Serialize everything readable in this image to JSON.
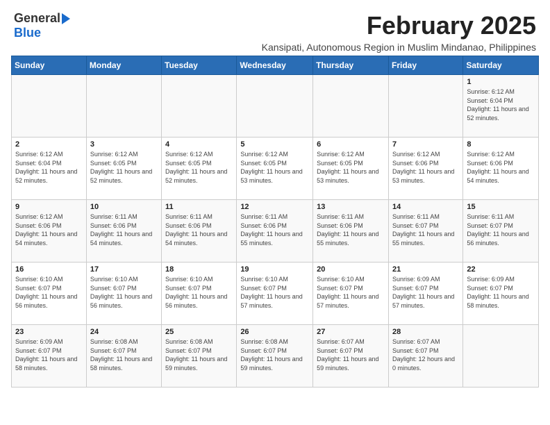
{
  "header": {
    "logo_general": "General",
    "logo_blue": "Blue",
    "main_title": "February 2025",
    "subtitle": "Kansipati, Autonomous Region in Muslim Mindanao, Philippines"
  },
  "calendar": {
    "days_of_week": [
      "Sunday",
      "Monday",
      "Tuesday",
      "Wednesday",
      "Thursday",
      "Friday",
      "Saturday"
    ],
    "weeks": [
      [
        {
          "day": "",
          "info": ""
        },
        {
          "day": "",
          "info": ""
        },
        {
          "day": "",
          "info": ""
        },
        {
          "day": "",
          "info": ""
        },
        {
          "day": "",
          "info": ""
        },
        {
          "day": "",
          "info": ""
        },
        {
          "day": "1",
          "info": "Sunrise: 6:12 AM\nSunset: 6:04 PM\nDaylight: 11 hours and 52 minutes."
        }
      ],
      [
        {
          "day": "2",
          "info": "Sunrise: 6:12 AM\nSunset: 6:04 PM\nDaylight: 11 hours and 52 minutes."
        },
        {
          "day": "3",
          "info": "Sunrise: 6:12 AM\nSunset: 6:05 PM\nDaylight: 11 hours and 52 minutes."
        },
        {
          "day": "4",
          "info": "Sunrise: 6:12 AM\nSunset: 6:05 PM\nDaylight: 11 hours and 52 minutes."
        },
        {
          "day": "5",
          "info": "Sunrise: 6:12 AM\nSunset: 6:05 PM\nDaylight: 11 hours and 53 minutes."
        },
        {
          "day": "6",
          "info": "Sunrise: 6:12 AM\nSunset: 6:05 PM\nDaylight: 11 hours and 53 minutes."
        },
        {
          "day": "7",
          "info": "Sunrise: 6:12 AM\nSunset: 6:06 PM\nDaylight: 11 hours and 53 minutes."
        },
        {
          "day": "8",
          "info": "Sunrise: 6:12 AM\nSunset: 6:06 PM\nDaylight: 11 hours and 54 minutes."
        }
      ],
      [
        {
          "day": "9",
          "info": "Sunrise: 6:12 AM\nSunset: 6:06 PM\nDaylight: 11 hours and 54 minutes."
        },
        {
          "day": "10",
          "info": "Sunrise: 6:11 AM\nSunset: 6:06 PM\nDaylight: 11 hours and 54 minutes."
        },
        {
          "day": "11",
          "info": "Sunrise: 6:11 AM\nSunset: 6:06 PM\nDaylight: 11 hours and 54 minutes."
        },
        {
          "day": "12",
          "info": "Sunrise: 6:11 AM\nSunset: 6:06 PM\nDaylight: 11 hours and 55 minutes."
        },
        {
          "day": "13",
          "info": "Sunrise: 6:11 AM\nSunset: 6:06 PM\nDaylight: 11 hours and 55 minutes."
        },
        {
          "day": "14",
          "info": "Sunrise: 6:11 AM\nSunset: 6:07 PM\nDaylight: 11 hours and 55 minutes."
        },
        {
          "day": "15",
          "info": "Sunrise: 6:11 AM\nSunset: 6:07 PM\nDaylight: 11 hours and 56 minutes."
        }
      ],
      [
        {
          "day": "16",
          "info": "Sunrise: 6:10 AM\nSunset: 6:07 PM\nDaylight: 11 hours and 56 minutes."
        },
        {
          "day": "17",
          "info": "Sunrise: 6:10 AM\nSunset: 6:07 PM\nDaylight: 11 hours and 56 minutes."
        },
        {
          "day": "18",
          "info": "Sunrise: 6:10 AM\nSunset: 6:07 PM\nDaylight: 11 hours and 56 minutes."
        },
        {
          "day": "19",
          "info": "Sunrise: 6:10 AM\nSunset: 6:07 PM\nDaylight: 11 hours and 57 minutes."
        },
        {
          "day": "20",
          "info": "Sunrise: 6:10 AM\nSunset: 6:07 PM\nDaylight: 11 hours and 57 minutes."
        },
        {
          "day": "21",
          "info": "Sunrise: 6:09 AM\nSunset: 6:07 PM\nDaylight: 11 hours and 57 minutes."
        },
        {
          "day": "22",
          "info": "Sunrise: 6:09 AM\nSunset: 6:07 PM\nDaylight: 11 hours and 58 minutes."
        }
      ],
      [
        {
          "day": "23",
          "info": "Sunrise: 6:09 AM\nSunset: 6:07 PM\nDaylight: 11 hours and 58 minutes."
        },
        {
          "day": "24",
          "info": "Sunrise: 6:08 AM\nSunset: 6:07 PM\nDaylight: 11 hours and 58 minutes."
        },
        {
          "day": "25",
          "info": "Sunrise: 6:08 AM\nSunset: 6:07 PM\nDaylight: 11 hours and 59 minutes."
        },
        {
          "day": "26",
          "info": "Sunrise: 6:08 AM\nSunset: 6:07 PM\nDaylight: 11 hours and 59 minutes."
        },
        {
          "day": "27",
          "info": "Sunrise: 6:07 AM\nSunset: 6:07 PM\nDaylight: 11 hours and 59 minutes."
        },
        {
          "day": "28",
          "info": "Sunrise: 6:07 AM\nSunset: 6:07 PM\nDaylight: 12 hours and 0 minutes."
        },
        {
          "day": "",
          "info": ""
        }
      ]
    ]
  }
}
